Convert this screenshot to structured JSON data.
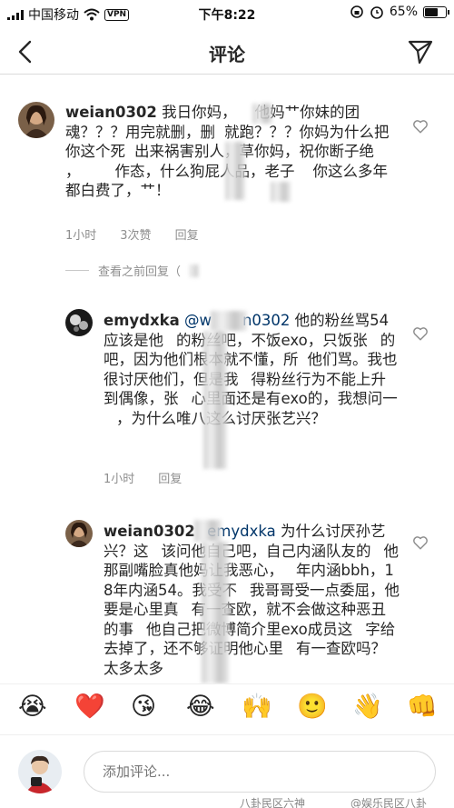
{
  "status_bar": {
    "carrier": "中国移动",
    "vpn": "VPN",
    "time": "下午8:22",
    "battery_percent": "65%",
    "battery_level": 0.65
  },
  "header": {
    "title": "评论"
  },
  "comments": [
    {
      "user": "weian0302",
      "lines": [
        "我日你妈，",
        "他妈艹你妹的团",
        "魂？？？用完就删，删",
        "就跑？？？你",
        "妈为什么把你这个死",
        "出来祸害别人，",
        "草你妈，祝你断子绝",
        "，",
        "作态，",
        "什么狗屁人品，老子",
        "你这么多年都白",
        "费了，艹！"
      ],
      "time": "1小时",
      "likes": "3次赞",
      "reply": "回复"
    },
    {
      "user": "emydxka",
      "mention": "@w",
      "mention_tail": "n0302",
      "lines": [
        "他的粉丝骂",
        "54应该是他",
        "的粉丝吧，不饭",
        "exo，只饭张",
        "的吧，因为他们根",
        "本就不懂，所",
        "他们骂。我也很讨厌",
        "他们，但是我",
        "得粉丝行为不能上升",
        "到偶像，张",
        "心里面还是有exo",
        "的，我想问一",
        "，为什么唯八这么讨",
        "厌张艺兴？"
      ],
      "time": "1小时",
      "reply": "回复"
    },
    {
      "user": "weian0302",
      "mention": "emydxka",
      "lines": [
        "为什么讨厌",
        "孙艺兴？这",
        "该问他自己吧，自己",
        "内涵队友的",
        "他那副嘴脸真他妈",
        "让我恶心，",
        "年内涵bbh，18年内涵",
        "54。我受不",
        "我哥哥受一点委屈，他",
        "要是心里真",
        "有一查欧，就不会做这",
        "种恶丑的事",
        "他自己把微博简介里",
        "exo成员这",
        "字给去掉了，还不够",
        "证明他心里",
        "有一查欧吗？太多太多"
      ]
    }
  ],
  "view_previous_replies": "查看之前回复（",
  "emojis": [
    "😭",
    "❤️",
    "😘",
    "😂",
    "🙌",
    "🙂",
    "👋",
    "👊"
  ],
  "input": {
    "placeholder": "添加评论..."
  },
  "watermarks": [
    "八卦民区六神",
    "@娱乐民区八卦"
  ]
}
